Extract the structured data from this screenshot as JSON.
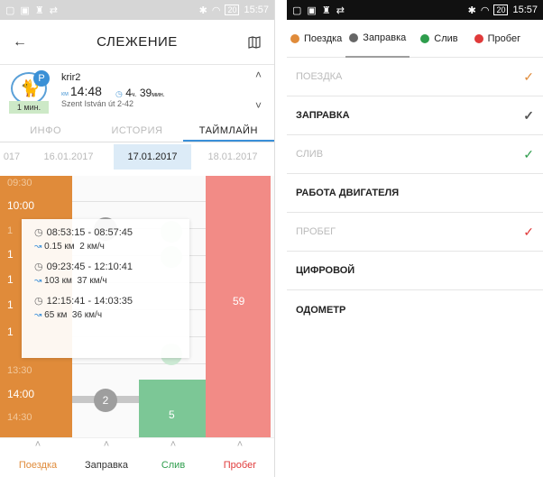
{
  "left": {
    "statusbar": {
      "time": "15:57",
      "battery": "20"
    },
    "header": {
      "title": "СЛЕЖЕНИЕ"
    },
    "vehicle": {
      "name": "krir2",
      "time_small": "км",
      "time": "14:48",
      "duration_val1": "4",
      "duration_unit1": "ч.",
      "duration_val2": "39",
      "duration_unit2": "мин.",
      "address": "Szent István út 2-42",
      "status_tag": "1 мин."
    },
    "tabs": [
      {
        "label": "ИНФО"
      },
      {
        "label": "ИСТОРИЯ"
      },
      {
        "label": "ТАЙМЛАЙН"
      }
    ],
    "dates": [
      {
        "label": "017"
      },
      {
        "label": "16.01.2017"
      },
      {
        "label": "17.01.2017"
      },
      {
        "label": "18.01.2017"
      }
    ],
    "timeline": {
      "labels": [
        "09:30",
        "10:00",
        "1",
        "1",
        "1",
        "1",
        "1",
        "13:30",
        "14:00",
        "14:30"
      ],
      "fuel_count": "2",
      "drain_value": "5",
      "run_value": "59",
      "popup": [
        {
          "range": "08:53:15 - 08:57:45",
          "dist": "0.15 км",
          "speed": "2 км/ч"
        },
        {
          "range": "09:23:45 - 12:10:41",
          "dist": "103 км",
          "speed": "37 км/ч"
        },
        {
          "range": "12:15:41 - 14:03:35",
          "dist": "65 км",
          "speed": "36 км/ч"
        }
      ]
    },
    "bottom_nav": [
      {
        "label": "Поездка",
        "color": "#e08b3a"
      },
      {
        "label": "Заправка",
        "color": "#333333"
      },
      {
        "label": "Слив",
        "color": "#2e9d4c"
      },
      {
        "label": "Пробег",
        "color": "#e03a3a"
      }
    ]
  },
  "right": {
    "statusbar": {
      "time": "15:57",
      "battery": "20"
    },
    "legend": [
      {
        "label": "Поездка",
        "color": "#e08b3a"
      },
      {
        "label": "Заправка",
        "color": "#666666"
      },
      {
        "label": "Слив",
        "color": "#2e9d4c"
      },
      {
        "label": "Пробег",
        "color": "#e03a3a"
      }
    ],
    "list": [
      {
        "label": "Поездка",
        "state": "dim",
        "check_color": "#e08b3a"
      },
      {
        "label": "Заправка",
        "state": "bold",
        "check_color": "#555555"
      },
      {
        "label": "Слив",
        "state": "dim",
        "check_color": "#2e9d4c"
      },
      {
        "label": "Работа двигателя",
        "state": "bold",
        "check_color": ""
      },
      {
        "label": "Пробег",
        "state": "dim",
        "check_color": "#e03a3a"
      },
      {
        "label": "Цифровой",
        "state": "bold",
        "check_color": ""
      },
      {
        "label": "Одометр",
        "state": "bold",
        "check_color": ""
      }
    ]
  }
}
